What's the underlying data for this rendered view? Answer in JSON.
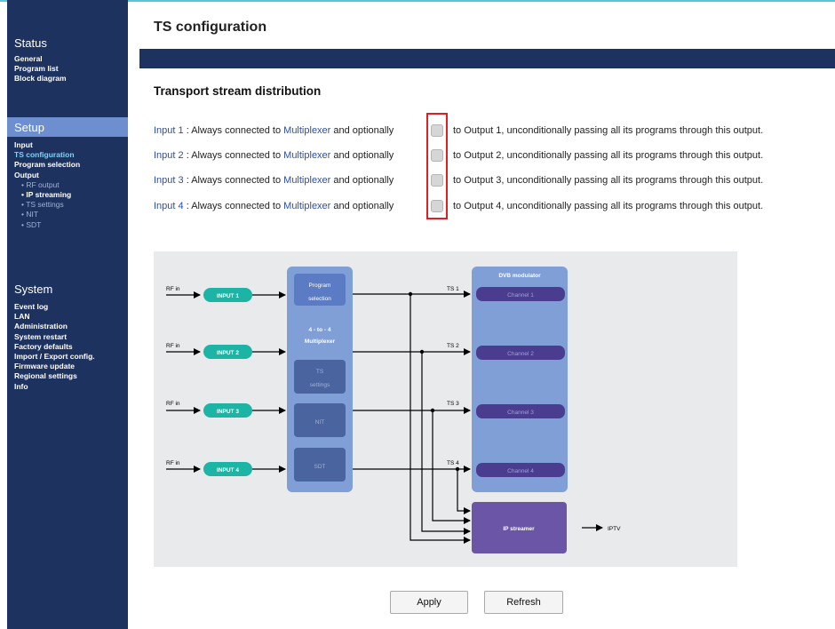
{
  "page": {
    "title": "TS configuration"
  },
  "sidebar": {
    "status": {
      "title": "Status",
      "items": [
        "General",
        "Program list",
        "Block diagram"
      ]
    },
    "setup": {
      "title": "Setup",
      "items": [
        "Input",
        "TS configuration",
        "Program selection",
        "Output"
      ],
      "subitems": [
        "RF output",
        "IP streaming",
        "TS settings",
        "NIT",
        "SDT"
      ]
    },
    "system": {
      "title": "System",
      "items": [
        "Event log",
        "LAN",
        "Administration",
        "System restart",
        "Factory defaults",
        "Import / Export config.",
        "Firmware update",
        "Regional settings",
        "Info"
      ]
    }
  },
  "distribution": {
    "heading": "Transport stream distribution",
    "rows": [
      {
        "input": "Input 1",
        "middle": " : Always connected to ",
        "mux": "Multiplexer",
        "optional": " and optionally",
        "rest": "to Output 1, unconditionally passing all its programs through this output.",
        "checked": false
      },
      {
        "input": "Input 2",
        "middle": " : Always connected to ",
        "mux": "Multiplexer",
        "optional": " and optionally",
        "rest": "to Output 2, unconditionally passing all its programs through this output.",
        "checked": false
      },
      {
        "input": "Input 3",
        "middle": " : Always connected to ",
        "mux": "Multiplexer",
        "optional": " and optionally",
        "rest": "to Output 3, unconditionally passing all its programs through this output.",
        "checked": false
      },
      {
        "input": "Input 4",
        "middle": " : Always connected to ",
        "mux": "Multiplexer",
        "optional": " and optionally",
        "rest": "to Output 4, unconditionally passing all its programs through this output.",
        "checked": false
      }
    ]
  },
  "diagram": {
    "rf_in": "RF in",
    "inputs": [
      "INPUT 1",
      "INPUT 2",
      "INPUT 3",
      "INPUT 4"
    ],
    "program_selection": [
      "Program",
      "selection"
    ],
    "multiplexer": [
      "4 - to - 4",
      "Multiplexer"
    ],
    "ts_settings": [
      "TS",
      "settings"
    ],
    "nit": "NIT",
    "sdt": "SDT",
    "ts_labels": [
      "TS 1",
      "TS 2",
      "TS 3",
      "TS 4"
    ],
    "dvb_modulator": "DVB modulator",
    "channels": [
      "Channel 1",
      "Channel 2",
      "Channel 3",
      "Channel 4"
    ],
    "ip_streamer": "IP streamer",
    "iptv": "IPTV"
  },
  "buttons": {
    "apply": "Apply",
    "refresh": "Refresh"
  },
  "colors": {
    "sidebar": "#1e3260",
    "setup_highlight": "#6d8fd0",
    "input_pill": "#1cb5a5",
    "mux_block": "#7f9fd6",
    "dvb_block": "#7f9fd6",
    "ip_streamer": "#6a55a6",
    "checkbox_highlight": "#e02020"
  }
}
